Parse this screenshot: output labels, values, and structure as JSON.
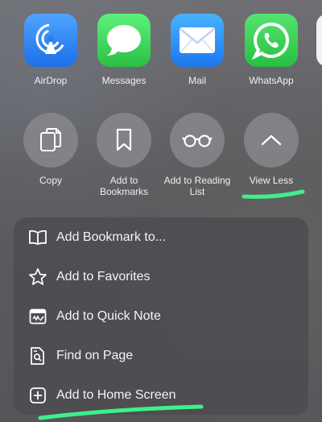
{
  "share_targets": [
    {
      "label": "AirDrop",
      "icon": "airdrop-icon"
    },
    {
      "label": "Messages",
      "icon": "messages-icon"
    },
    {
      "label": "Mail",
      "icon": "mail-icon"
    },
    {
      "label": "WhatsApp",
      "icon": "whatsapp-icon"
    }
  ],
  "actions": [
    {
      "label": "Copy",
      "icon": "copy-icon"
    },
    {
      "label": "Add to\nBookmarks",
      "icon": "bookmark-icon"
    },
    {
      "label": "Add to Reading\nList",
      "icon": "glasses-icon"
    },
    {
      "label": "View Less",
      "icon": "chevron-up-icon"
    }
  ],
  "menu": [
    {
      "label": "Add Bookmark to...",
      "icon": "book-open-icon"
    },
    {
      "label": "Add to Favorites",
      "icon": "star-icon"
    },
    {
      "label": "Add to Quick Note",
      "icon": "quick-note-icon"
    },
    {
      "label": "Find on Page",
      "icon": "find-on-page-icon"
    },
    {
      "label": "Add to Home Screen",
      "icon": "plus-square-icon"
    }
  ],
  "colors": {
    "highlight": "#3ef08a",
    "sheet_background": "#5c5c5f",
    "menu_background": "#4c4c50",
    "text": "#f4f4f4"
  }
}
